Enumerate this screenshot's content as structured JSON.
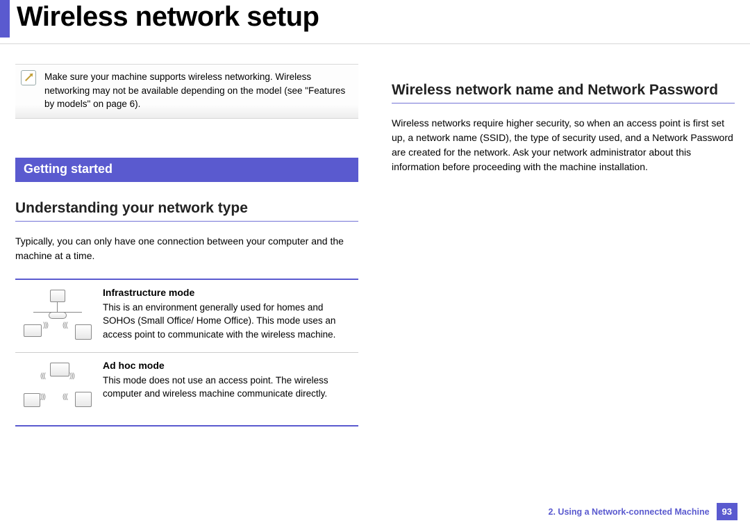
{
  "title": "Wireless network setup",
  "note": {
    "text": "Make sure your machine supports wireless networking. Wireless networking may not be available depending on the model (see \"Features by models\" on page 6)."
  },
  "section_tab": "Getting started",
  "left": {
    "heading": "Understanding your network type",
    "intro": "Typically, you can only have one connection between your computer and the machine at a time.",
    "modes": [
      {
        "title": "Infrastructure mode",
        "body": "This is an environment generally used for homes and SOHOs (Small Office/ Home Office). This mode uses an access point to communicate with the wireless machine."
      },
      {
        "title": "Ad hoc mode",
        "body": "This mode does not use an access point. The wireless computer and wireless machine communicate directly."
      }
    ]
  },
  "right": {
    "heading": "Wireless network name and Network Password",
    "body": "Wireless networks require higher security, so when an access point is first set up, a network name (SSID), the type of security used, and a Network Password are created for the network. Ask your network administrator about this information before proceeding with the machine installation."
  },
  "footer": {
    "chapter": "2.  Using a Network-connected Machine",
    "page": "93"
  }
}
